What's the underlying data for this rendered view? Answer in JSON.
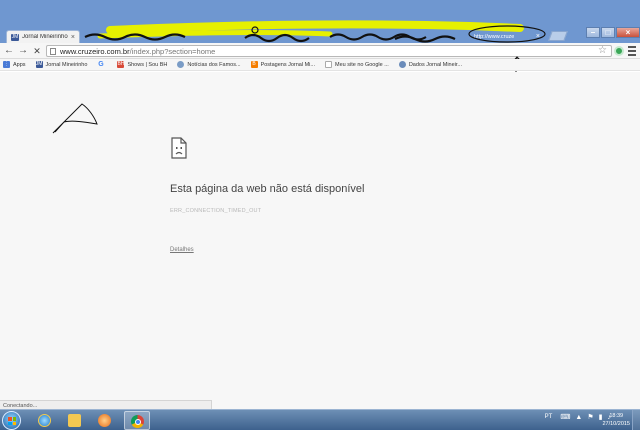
{
  "browser": {
    "tabs": [
      {
        "label": "Jornal Mineirinho",
        "favicon": "JM"
      },
      {
        "label": "http://www.cruze",
        "favicon": ""
      }
    ],
    "address_url_host": "www.cruzeiro.com.br",
    "address_url_rest": "/index.php?section=home",
    "bookmarks": [
      {
        "label": "Apps",
        "icon": "apps-icon",
        "color": "#4a7bd6"
      },
      {
        "label": "Jornal Mineirinho",
        "icon": "jm-icon",
        "color": "#3b5998"
      },
      {
        "label": "",
        "icon": "google-icon",
        "color": "#4285f4"
      },
      {
        "label": "Shows | Sou BH",
        "icon": "soubh-icon",
        "color": "#d84a38"
      },
      {
        "label": "Notícias dos Famos...",
        "icon": "noticias-icon",
        "color": "#7a9cc6"
      },
      {
        "label": "Postagens Jornal Mi...",
        "icon": "blogger-icon",
        "color": "#f57d00"
      },
      {
        "label": "Meu site no Google ...",
        "icon": "page-icon",
        "color": "#aaaaaa"
      },
      {
        "label": "Dados Jornal Mineir...",
        "icon": "analytics-icon",
        "color": "#6b8cba"
      }
    ]
  },
  "page": {
    "error_title": "Esta página da web não está disponível",
    "error_code": "ERR_CONNECTION_TIMED_OUT",
    "details_link": "Detalhes"
  },
  "status_bar": {
    "text": "Conectando..."
  },
  "taskbar": {
    "language": "PT",
    "time": "18:39",
    "date": "27/10/2015"
  },
  "colors": {
    "titlebar": "#6f97d0",
    "taskbar": "#3d618d",
    "highlight_scribble": "#e6f000"
  }
}
